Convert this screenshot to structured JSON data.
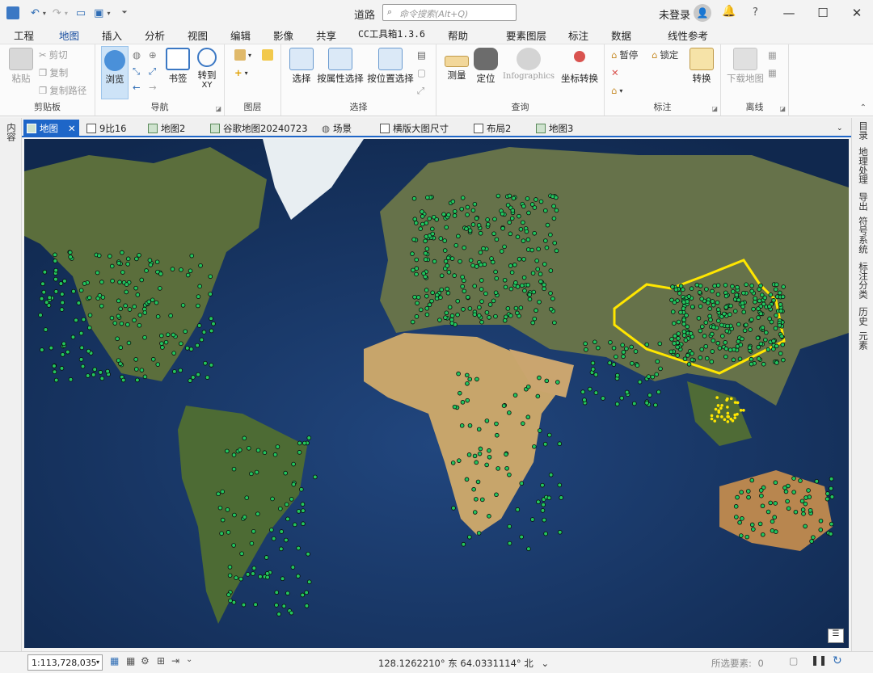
{
  "title": "道路",
  "command_search": {
    "placeholder": "命令搜索(Alt+Q)"
  },
  "account": {
    "signin": "未登录",
    "help": "?"
  },
  "menu_tabs": [
    "工程",
    "地图",
    "插入",
    "分析",
    "视图",
    "编辑",
    "影像",
    "共享",
    "CC工具箱1.3.6",
    "帮助"
  ],
  "context_tabs": [
    "要素图层",
    "标注",
    "数据"
  ],
  "context_tab2": "线性参考",
  "ribbon": {
    "clipboard": {
      "label": "剪贴板",
      "paste": "粘贴",
      "cut": "剪切",
      "copy": "复制",
      "copy_path": "复制路径"
    },
    "navigate": {
      "label": "导航",
      "explore": "浏览",
      "bookmarks": "书签",
      "goto_top": "转到",
      "goto_bottom": "XY"
    },
    "layer": {
      "label": "图层"
    },
    "selection": {
      "label": "选择",
      "select": "选择",
      "by_attr": "按属性选择",
      "by_loc": "按位置选择"
    },
    "inquiry": {
      "label": "查询",
      "measure": "测量",
      "locate": "定位",
      "infographics": "Infographics",
      "convert": "坐标转换"
    },
    "labeling": {
      "label": "标注",
      "pause": "暂停",
      "lock": "锁定",
      "convert": "转换"
    },
    "offline": {
      "label": "离线",
      "download": "下载地图"
    }
  },
  "doc_tabs": [
    "地图",
    "9比16",
    "地图2",
    "谷歌地图20240723",
    "场景",
    "横版大图尺寸",
    "布局2",
    "地图3"
  ],
  "left_panel": [
    "内容"
  ],
  "right_panel": [
    "目录",
    "地理处理",
    "导出",
    "符号系统",
    "标注分类",
    "历史",
    "元素"
  ],
  "status": {
    "scale": "1:113,728,035",
    "coords": "128.1262210° 东 64.0331114° 北",
    "selected_label": "所选要素:",
    "selected_count": "0"
  },
  "colors": {
    "accent": "#1e66c8",
    "points": "#22c55e",
    "china_outline": "#ffe600"
  }
}
